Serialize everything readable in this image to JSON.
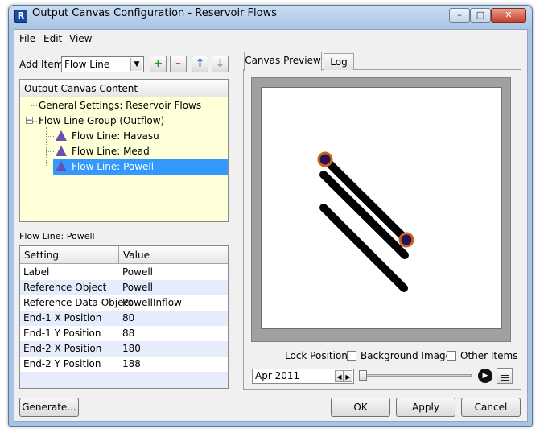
{
  "window": {
    "title": "Output Canvas Configuration - Reservoir Flows",
    "app_icon_letter": "R",
    "controls": {
      "minimize": "–",
      "maximize": "□",
      "close": "✕"
    }
  },
  "menu": [
    "File",
    "Edit",
    "View"
  ],
  "toolbar": {
    "add_item_label": "Add Item:",
    "add_item_value": "Flow Line",
    "buttons": {
      "add": "+",
      "remove": "–",
      "move_up": "↑",
      "move_down": "↓"
    }
  },
  "tree": {
    "header": "Output Canvas Content",
    "items": [
      {
        "label": "General Settings: Reservoir Flows"
      },
      {
        "label": "Flow Line Group (Outflow)",
        "expander": "−"
      },
      {
        "label": "Flow Line: Havasu"
      },
      {
        "label": "Flow Line: Mead"
      },
      {
        "label": "Flow Line: Powell"
      }
    ]
  },
  "properties": {
    "caption": "Flow Line: Powell",
    "col_setting": "Setting",
    "col_value": "Value",
    "rows": [
      {
        "setting": "Label",
        "value": "Powell"
      },
      {
        "setting": "Reference Object",
        "value": "Powell"
      },
      {
        "setting": "Reference Data Object",
        "value": "PowellInflow"
      },
      {
        "setting": "End-1 X Position",
        "value": "80"
      },
      {
        "setting": "End-1 Y Position",
        "value": "88"
      },
      {
        "setting": "End-2 X Position",
        "value": "180"
      },
      {
        "setting": "End-2 Y Position",
        "value": "188"
      }
    ]
  },
  "tabs": [
    "Canvas Preview",
    "Log"
  ],
  "preview": {
    "lock_label": "Lock Positions:",
    "background_images": "Background Images",
    "other_items": "Other Items",
    "date": "Apr 2011"
  },
  "buttons": {
    "generate": "Generate...",
    "ok": "OK",
    "apply": "Apply",
    "cancel": "Cancel"
  },
  "colors": {
    "selection": "#3399ff",
    "tree_bg": "#ffffd8",
    "flow_line": "#000000",
    "endpoint_ring": "#c8621e",
    "endpoint_fill": "#2a1450",
    "flowline_icon": "#6b4fb3"
  }
}
